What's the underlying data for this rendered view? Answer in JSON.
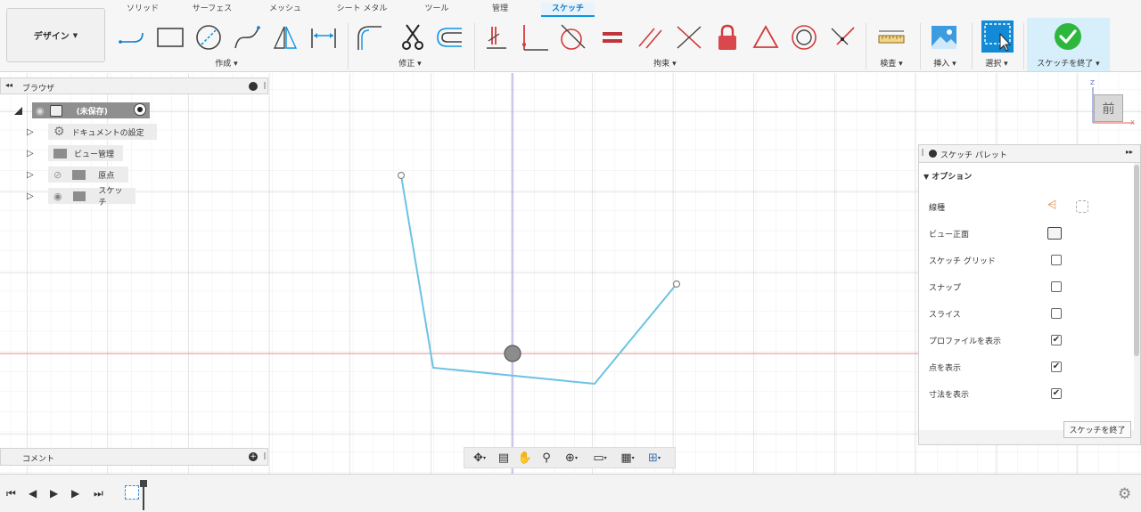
{
  "ribbon": {
    "workspace": "デザイン",
    "tabs": [
      "ソリッド",
      "サーフェス",
      "メッシュ",
      "シート メタル",
      "ツール",
      "管理",
      "スケッチ"
    ],
    "active_tab": "スケッチ",
    "groups": {
      "create": "作成",
      "modify": "修正",
      "constraints": "拘束",
      "inspect": "検査",
      "insert": "挿入",
      "select": "選択",
      "finish": "スケッチを終了"
    }
  },
  "browser": {
    "title": "ブラウザ",
    "root": "(未保存)",
    "items": [
      {
        "label": "ドキュメントの設定",
        "icon": "gear-icon"
      },
      {
        "label": "ビュー管理",
        "icon": "folder-icon"
      },
      {
        "label": "原点",
        "icon": "folder-icon"
      },
      {
        "label": "スケッチ",
        "icon": "folder-icon"
      }
    ]
  },
  "comments": {
    "title": "コメント"
  },
  "viewcube": {
    "face": "前",
    "axis_z": "Z",
    "axis_x": "X"
  },
  "palette": {
    "title": "スケッチ パレット",
    "section": "オプション",
    "rows": [
      {
        "label": "線種",
        "kind": "icons"
      },
      {
        "label": "ビュー正面",
        "kind": "icon"
      },
      {
        "label": "スケッチ グリッド",
        "kind": "checkbox",
        "checked": false
      },
      {
        "label": "スナップ",
        "kind": "checkbox",
        "checked": false
      },
      {
        "label": "スライス",
        "kind": "checkbox",
        "checked": false
      },
      {
        "label": "プロファイルを表示",
        "kind": "checkbox",
        "checked": true
      },
      {
        "label": "点を表示",
        "kind": "checkbox",
        "checked": true
      },
      {
        "label": "寸法を表示",
        "kind": "checkbox",
        "checked": true
      }
    ],
    "finish_button": "スケッチを終了"
  },
  "colors": {
    "accent": "#0a96e6",
    "sketch_line": "#6cc3e3",
    "constraint_red": "#d23b3b",
    "finish_green": "#2db83d"
  }
}
